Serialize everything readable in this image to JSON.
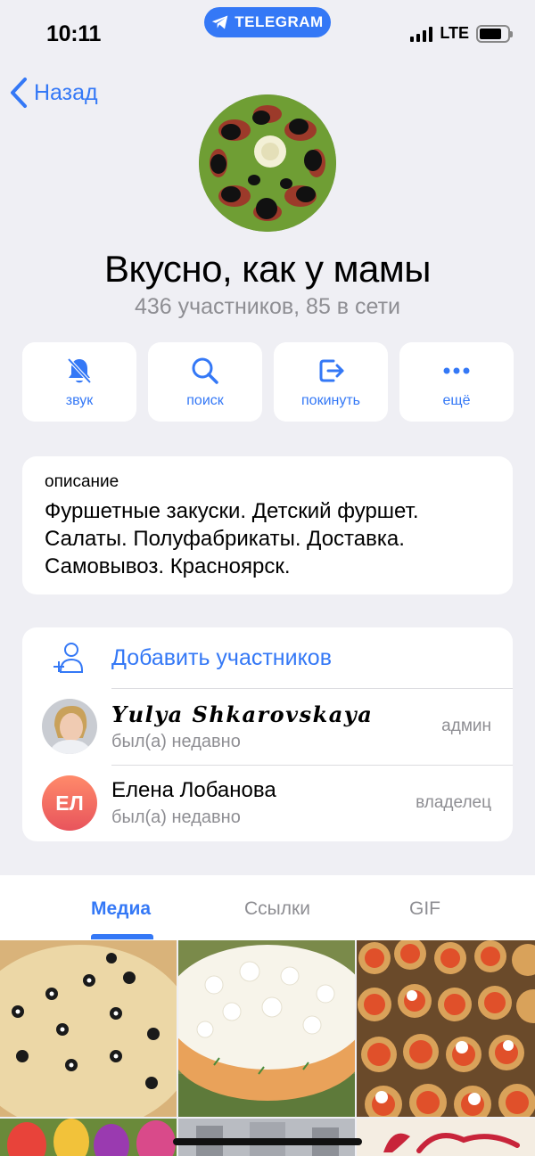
{
  "status_bar": {
    "time": "10:11",
    "app_pill": "TELEGRAM",
    "network": "LTE",
    "battery_level": 0.8
  },
  "nav": {
    "back_label": "Назад"
  },
  "group": {
    "title": "Вкусно, как у мамы",
    "subtitle": "436 участников, 85 в сети"
  },
  "actions": [
    {
      "label": "звук",
      "icon": "bell-mute-icon"
    },
    {
      "label": "поиск",
      "icon": "search-icon"
    },
    {
      "label": "покинуть",
      "icon": "leave-icon"
    },
    {
      "label": "ещё",
      "icon": "more-icon"
    }
  ],
  "description": {
    "label": "описание",
    "text": "Фуршетные закуски. Детский фуршет.\nСалаты. Полуфабрикаты. Доставка.\nСамовывоз. Красноярск."
  },
  "members": {
    "add_label": "Добавить участников",
    "list": [
      {
        "name": "𝒀𝒖𝒍𝒚𝒂 𝑺𝒉𝒌𝒂𝒓𝒐𝒗𝒔𝒌𝒂𝒚𝒂",
        "status": "был(а) недавно",
        "role": "админ"
      },
      {
        "name": "Елена Лобанова",
        "initials": "ЕЛ",
        "status": "был(а) недавно",
        "role": "владелец"
      }
    ]
  },
  "tabs": [
    {
      "label": "Медиа",
      "active": true
    },
    {
      "label": "Ссылки",
      "active": false
    },
    {
      "label": "GIF",
      "active": false
    }
  ],
  "media_cell_count": 6,
  "colors": {
    "accent": "#3478f6",
    "background": "#efeff4",
    "secondary_text": "#8e8e93"
  }
}
